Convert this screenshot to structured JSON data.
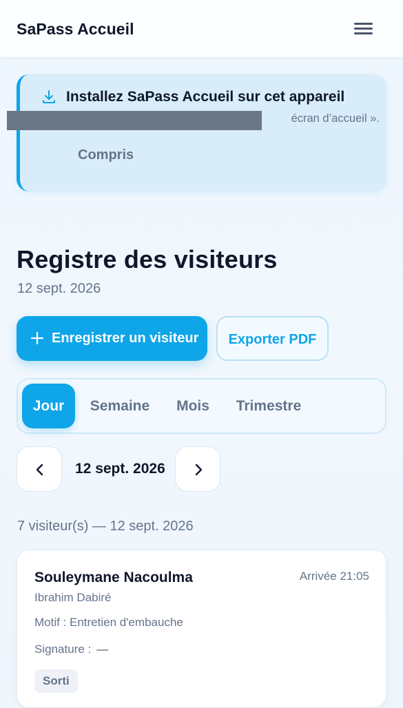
{
  "header": {
    "app_title": "SaPass Accueil",
    "menu_icon": "hamburger-menu-icon"
  },
  "install_banner": {
    "icon": "download-icon",
    "title": "Installez SaPass Accueil sur cet appareil",
    "description_visible": "écran d’accueil ».",
    "dismiss_label": "Compris"
  },
  "page": {
    "title": "Registre des visiteurs",
    "date": "12 sept. 2026"
  },
  "actions": {
    "register_label": "Enregistrer un visiteur",
    "export_label": "Exporter PDF"
  },
  "tabs": [
    {
      "label": "Jour",
      "active": true
    },
    {
      "label": "Semaine",
      "active": false
    },
    {
      "label": "Mois",
      "active": false
    },
    {
      "label": "Trimestre",
      "active": false
    }
  ],
  "date_nav": {
    "current": "12 sept. 2026",
    "prev_icon": "chevron-left-icon",
    "next_icon": "chevron-right-icon"
  },
  "summary": {
    "count_line": "7 visiteur(s) — 12 sept. 2026"
  },
  "visitors": [
    {
      "name": "Souleymane Nacoulma",
      "arrival": "Arrivée 21:05",
      "host": "Ibrahim Dabiré",
      "purpose": "Motif : Entretien d'embauche",
      "signature_label": "Signature :",
      "signature_value": "—",
      "status": "Sorti"
    }
  ],
  "colors": {
    "accent": "#0ea5e9",
    "text_primary": "#0f172a",
    "text_muted": "#64748b",
    "banner_bg": "#d8ecfa"
  }
}
